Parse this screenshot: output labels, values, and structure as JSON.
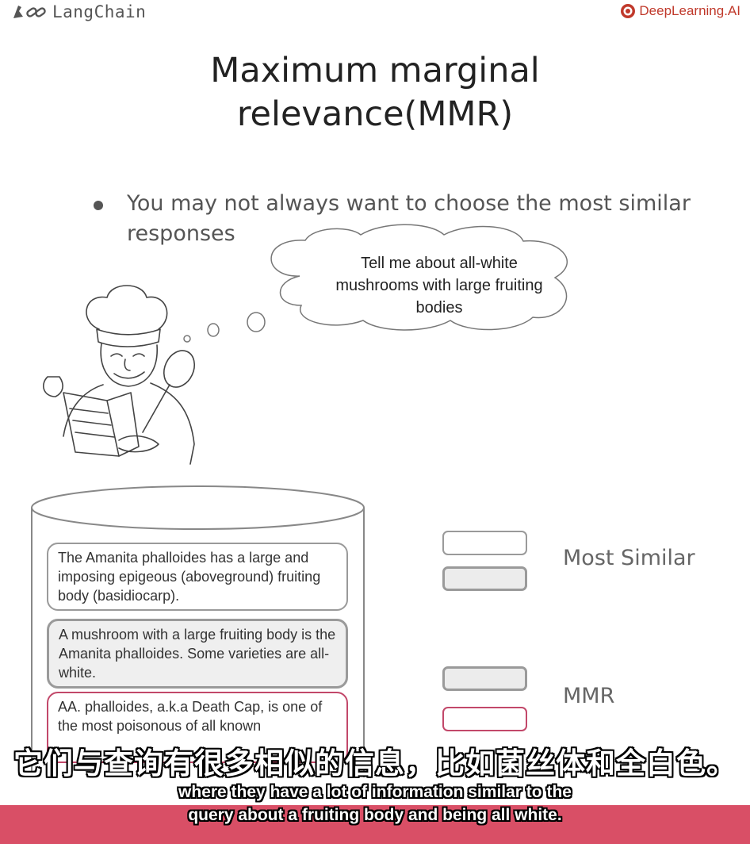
{
  "header": {
    "left_brand": "LangChain",
    "right_brand": "DeepLearning.AI"
  },
  "slide": {
    "title_line1": "Maximum marginal",
    "title_line2": "relevance(MMR)",
    "bullet": "You may not always want to choose the most similar  responses",
    "query_bubble": "Tell me about all-white mushrooms with large fruiting bodies",
    "documents": [
      "The Amanita phalloides has a large and imposing epigeous (aboveground) fruiting body (basidiocarp).",
      "A mushroom with a large fruiting body is the Amanita phalloides. Some varieties are all-white.",
      "AA. phalloides, a.k.a Death Cap, is one of the most poisonous of all known"
    ],
    "label_most_similar": "Most Similar",
    "label_mmr": "MMR"
  },
  "subtitles": {
    "zh": "它们与查询有很多相似的信息，比如菌丝体和全白色。",
    "en_line1": "where they have a lot of information similar to the",
    "en_line2": "query about a fruiting body and being all white."
  },
  "colors": {
    "accent_pink": "#c2486a",
    "subtitle_band": "#d94f66",
    "brand_red": "#c0392b",
    "gray_border": "#9a9a9a"
  }
}
